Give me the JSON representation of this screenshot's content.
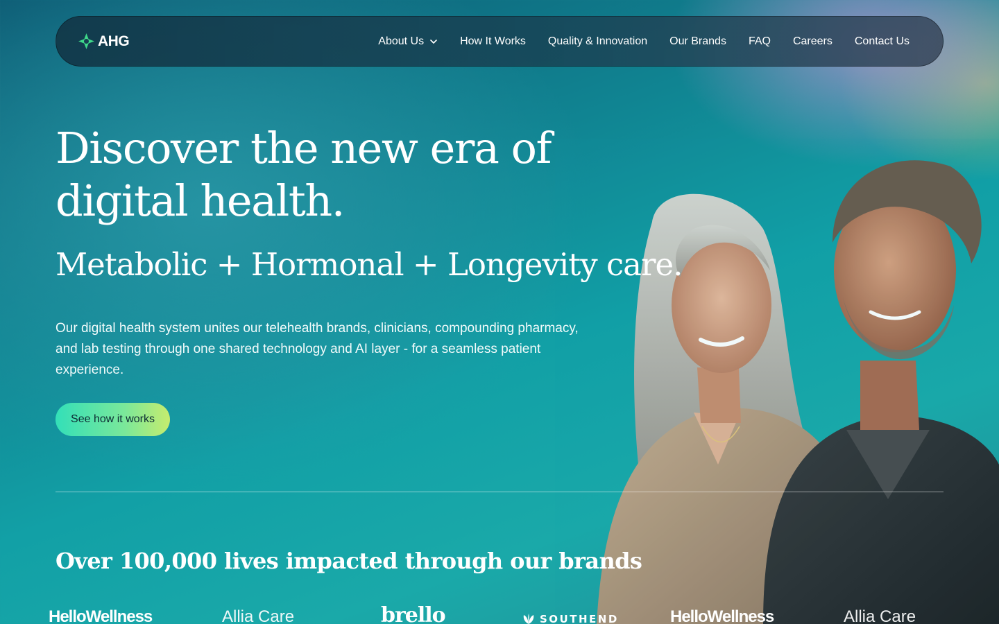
{
  "nav": {
    "logo_text": "AHG",
    "items": [
      {
        "label": "About Us",
        "has_dropdown": true
      },
      {
        "label": "How It Works"
      },
      {
        "label": "Quality & Innovation"
      },
      {
        "label": "Our Brands"
      },
      {
        "label": "FAQ"
      },
      {
        "label": "Careers"
      },
      {
        "label": "Contact Us"
      }
    ]
  },
  "hero": {
    "title": "Discover the new era of digital health.",
    "subtitle": "Metabolic + Hormonal + Longevity care.",
    "body": "Our digital health system unites our telehealth brands, clinicians, compounding pharmacy, and lab testing through one shared technology and AI layer - for a seamless patient experience.",
    "cta_label": "See how it works"
  },
  "impact": {
    "headline": "Over 100,000 lives impacted through our brands"
  },
  "brands": [
    "HelloWellness",
    "Allia Care",
    "brello",
    "SOUTHEND",
    "HelloWellness",
    "Allia Care"
  ],
  "colors": {
    "cta_gradient_start": "#33dfb8",
    "cta_gradient_end": "#c6ec6e",
    "logo_green": "#3fd98a",
    "nav_bg": "#173f52"
  }
}
